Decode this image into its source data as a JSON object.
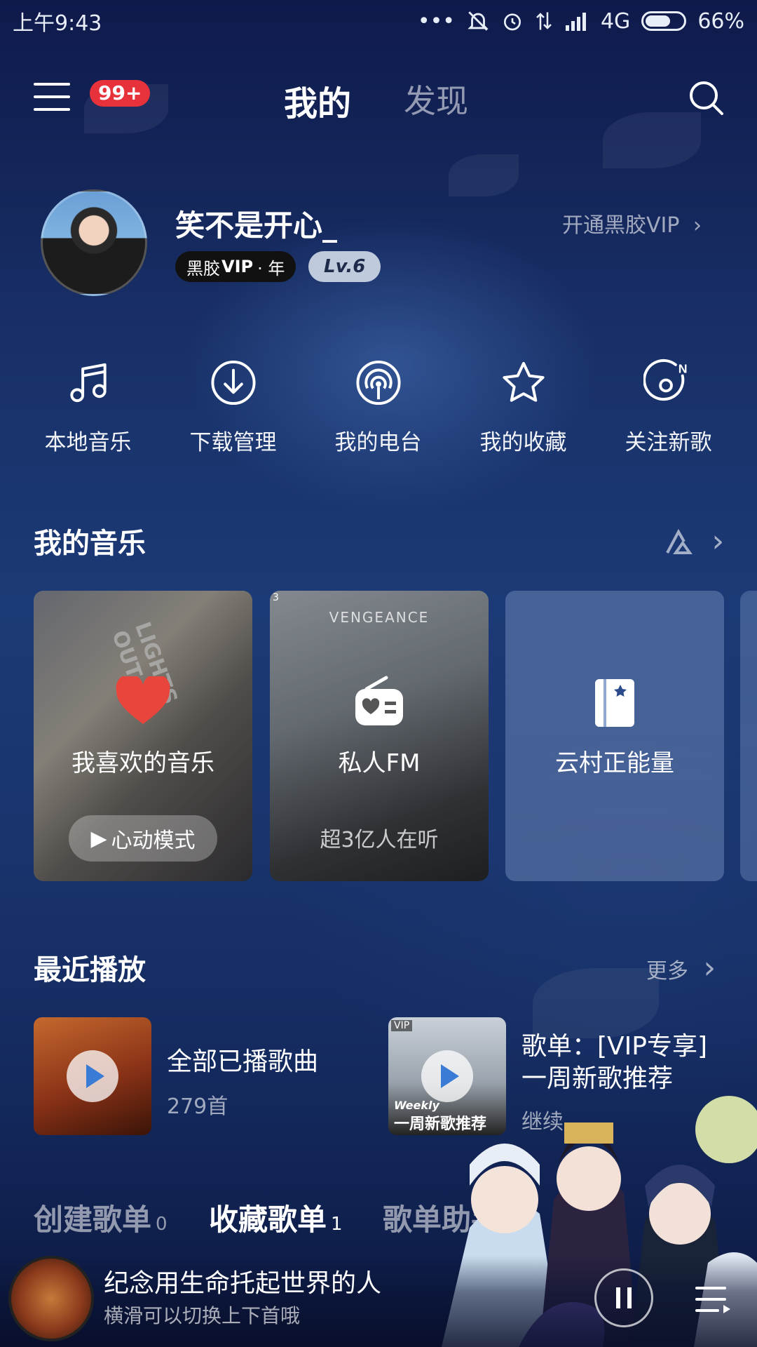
{
  "status_bar": {
    "time": "上午9:43",
    "network": "4G",
    "battery": "66%",
    "battery_level": 0.66
  },
  "header": {
    "menu_badge": "99+",
    "tab_mine": "我的",
    "tab_discover": "发现"
  },
  "profile": {
    "username": "笑不是开心_",
    "vip_badge": "黑胶",
    "vip_badge_mark": "VIP",
    "vip_badge_period": "· 年",
    "level": "Lv.6",
    "open_vip": "开通黑胶VIP"
  },
  "quick_actions": [
    {
      "label": "本地音乐",
      "icon": "music-note-icon"
    },
    {
      "label": "下载管理",
      "icon": "download-icon"
    },
    {
      "label": "我的电台",
      "icon": "radio-station-icon"
    },
    {
      "label": "我的收藏",
      "icon": "star-icon"
    },
    {
      "label": "关注新歌",
      "icon": "new-song-icon"
    }
  ],
  "my_music": {
    "title": "我的音乐",
    "cards": [
      {
        "title": "我喜欢的音乐",
        "action": "心动模式",
        "cover_text": "LIGHTS OUT"
      },
      {
        "title": "私人FM",
        "subtitle": "超3亿人在听",
        "cover_text": "VENGEANCE",
        "corner_num": "3"
      },
      {
        "title": "云村正能量"
      }
    ]
  },
  "recent": {
    "title": "最近播放",
    "more": "更多",
    "items": [
      {
        "title": "全部已播歌曲",
        "subtitle": "279首"
      },
      {
        "title_line1": "歌单：[VIP专享]",
        "title_line2": "一周新歌推荐",
        "subtitle": "继续",
        "cover_top": "Weekly",
        "cover_label": "一周新歌推荐",
        "cover_tag": "VIP"
      }
    ]
  },
  "playlist_tabs": [
    {
      "label": "创建歌单",
      "count": "0"
    },
    {
      "label": "收藏歌单",
      "count": "1"
    },
    {
      "label": "歌单助手",
      "count": ""
    }
  ],
  "mini_player": {
    "title": "纪念用生命托起世界的人",
    "hint": "横滑可以切换上下首哦"
  },
  "colors": {
    "badge_red": "#e8323b",
    "heart_red": "#e8453c",
    "bg_top": "#0f1a4b",
    "bg_mid": "#1c3a77"
  }
}
